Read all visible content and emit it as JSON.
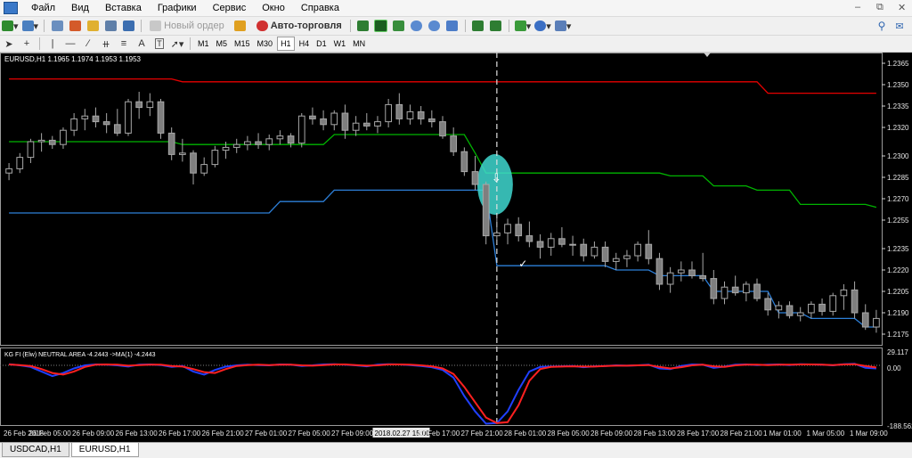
{
  "menu": [
    "Файл",
    "Вид",
    "Вставка",
    "Графики",
    "Сервис",
    "Окно",
    "Справка"
  ],
  "toolbar": {
    "new_order": "Новый ордер",
    "auto_trading": "Авто-торговля"
  },
  "timeframes": [
    "M1",
    "M5",
    "M15",
    "M30",
    "H1",
    "H4",
    "D1",
    "W1",
    "MN"
  ],
  "active_timeframe": "H1",
  "chart": {
    "header": "EURUSD,H1  1.1965 1.1974 1.1953 1.1953",
    "price_labels": [
      "1.2365",
      "1.2350",
      "1.2335",
      "1.2320",
      "1.2300",
      "1.2285",
      "1.2270",
      "1.2255",
      "1.2235",
      "1.2220",
      "1.2205",
      "1.2190",
      "1.2175"
    ],
    "time_labels": [
      "26 Feb 2018",
      "26 Feb 05:00",
      "26 Feb 09:00",
      "26 Feb 13:00",
      "26 Feb 17:00",
      "26 Feb 21:00",
      "27 Feb 01:00",
      "27 Feb 05:00",
      "27 Feb 09:00",
      "2018.02.27 15:00",
      "27 Feb 17:00",
      "27 Feb 21:00",
      "28 Feb 01:00",
      "28 Feb 05:00",
      "28 Feb 09:00",
      "28 Feb 13:00",
      "28 Feb 17:00",
      "28 Feb 21:00",
      "1 Mar 01:00",
      "1 Mar 05:00",
      "1 Mar 09:00"
    ],
    "indicator_header": "KG FI   (Elw)   NEUTRAL AREA   -4.2443  ->MA(1) -4.2443",
    "indicator_scale": [
      "29.117",
      "0.00",
      "-188.562"
    ]
  },
  "chart_data": {
    "type": "candlestick",
    "symbol": "EURUSD",
    "timeframe": "H1",
    "ylim": [
      1.217,
      1.237
    ],
    "candles_ohlc": [
      [
        1.2288,
        1.2295,
        1.2283,
        1.2291
      ],
      [
        1.2291,
        1.2302,
        1.2288,
        1.2299
      ],
      [
        1.2299,
        1.2312,
        1.2295,
        1.231
      ],
      [
        1.231,
        1.2316,
        1.2303,
        1.2311
      ],
      [
        1.2311,
        1.2314,
        1.2305,
        1.2308
      ],
      [
        1.2308,
        1.232,
        1.2305,
        1.2318
      ],
      [
        1.2318,
        1.233,
        1.2314,
        1.2326
      ],
      [
        1.2326,
        1.2333,
        1.2318,
        1.2328
      ],
      [
        1.2328,
        1.2334,
        1.232,
        1.2324
      ],
      [
        1.2324,
        1.233,
        1.2316,
        1.2322
      ],
      [
        1.2322,
        1.2333,
        1.2314,
        1.2316
      ],
      [
        1.2316,
        1.234,
        1.2314,
        1.2338
      ],
      [
        1.2338,
        1.2345,
        1.2326,
        1.2334
      ],
      [
        1.2334,
        1.2344,
        1.2328,
        1.2338
      ],
      [
        1.2338,
        1.234,
        1.2312,
        1.2316
      ],
      [
        1.2316,
        1.232,
        1.2297,
        1.2301
      ],
      [
        1.2301,
        1.2312,
        1.2296,
        1.2302
      ],
      [
        1.2302,
        1.2304,
        1.228,
        1.2288
      ],
      [
        1.2288,
        1.2299,
        1.2286,
        1.2294
      ],
      [
        1.2294,
        1.2307,
        1.2292,
        1.2304
      ],
      [
        1.2304,
        1.231,
        1.2298,
        1.2306
      ],
      [
        1.2306,
        1.2312,
        1.2302,
        1.2308
      ],
      [
        1.2308,
        1.2314,
        1.2304,
        1.231
      ],
      [
        1.231,
        1.2316,
        1.2305,
        1.2308
      ],
      [
        1.2308,
        1.2315,
        1.2304,
        1.2312
      ],
      [
        1.2312,
        1.2318,
        1.2308,
        1.2314
      ],
      [
        1.2314,
        1.2316,
        1.2306,
        1.2309
      ],
      [
        1.2309,
        1.233,
        1.2306,
        1.2328
      ],
      [
        1.2328,
        1.2334,
        1.2322,
        1.2326
      ],
      [
        1.2326,
        1.2332,
        1.2318,
        1.2322
      ],
      [
        1.2322,
        1.2332,
        1.2318,
        1.233
      ],
      [
        1.233,
        1.2336,
        1.2312,
        1.2318
      ],
      [
        1.2318,
        1.2328,
        1.2314,
        1.2323
      ],
      [
        1.2323,
        1.233,
        1.2318,
        1.2321
      ],
      [
        1.2321,
        1.2328,
        1.2316,
        1.2324
      ],
      [
        1.2324,
        1.234,
        1.232,
        1.2336
      ],
      [
        1.2336,
        1.2344,
        1.2322,
        1.2326
      ],
      [
        1.2326,
        1.2336,
        1.2322,
        1.2331
      ],
      [
        1.2331,
        1.2335,
        1.2322,
        1.2326
      ],
      [
        1.2326,
        1.2332,
        1.232,
        1.2324
      ],
      [
        1.2324,
        1.2328,
        1.2312,
        1.2314
      ],
      [
        1.2314,
        1.232,
        1.23,
        1.2303
      ],
      [
        1.2303,
        1.2306,
        1.2286,
        1.2289
      ],
      [
        1.2289,
        1.23,
        1.2276,
        1.228
      ],
      [
        1.228,
        1.2282,
        1.2238,
        1.2244
      ],
      [
        1.2244,
        1.2258,
        1.2238,
        1.2246
      ],
      [
        1.2246,
        1.2256,
        1.2238,
        1.2252
      ],
      [
        1.2252,
        1.2257,
        1.224,
        1.2244
      ],
      [
        1.2244,
        1.2254,
        1.2236,
        1.224
      ],
      [
        1.224,
        1.2245,
        1.2228,
        1.2236
      ],
      [
        1.2236,
        1.2246,
        1.223,
        1.2242
      ],
      [
        1.2242,
        1.225,
        1.2236,
        1.2238
      ],
      [
        1.2238,
        1.2244,
        1.223,
        1.2238
      ],
      [
        1.2238,
        1.2242,
        1.2226,
        1.223
      ],
      [
        1.223,
        1.224,
        1.2228,
        1.2236
      ],
      [
        1.2236,
        1.224,
        1.2222,
        1.2226
      ],
      [
        1.2226,
        1.2232,
        1.222,
        1.2228
      ],
      [
        1.2228,
        1.2234,
        1.2222,
        1.223
      ],
      [
        1.223,
        1.224,
        1.2226,
        1.2238
      ],
      [
        1.2238,
        1.2248,
        1.2224,
        1.2228
      ],
      [
        1.2228,
        1.2232,
        1.2206,
        1.221
      ],
      [
        1.221,
        1.2222,
        1.2204,
        1.2218
      ],
      [
        1.2218,
        1.2226,
        1.2212,
        1.222
      ],
      [
        1.222,
        1.2226,
        1.2214,
        1.2216
      ],
      [
        1.2216,
        1.2232,
        1.2212,
        1.2214
      ],
      [
        1.2214,
        1.222,
        1.2196,
        1.22
      ],
      [
        1.22,
        1.2212,
        1.2196,
        1.2208
      ],
      [
        1.2208,
        1.2216,
        1.2202,
        1.2204
      ],
      [
        1.2204,
        1.2212,
        1.2198,
        1.221
      ],
      [
        1.221,
        1.2214,
        1.2198,
        1.22
      ],
      [
        1.22,
        1.2204,
        1.2188,
        1.2192
      ],
      [
        1.2192,
        1.2198,
        1.2186,
        1.2195
      ],
      [
        1.2195,
        1.2198,
        1.2186,
        1.2188
      ],
      [
        1.2188,
        1.2194,
        1.2184,
        1.219
      ],
      [
        1.219,
        1.2198,
        1.2186,
        1.2196
      ],
      [
        1.2196,
        1.22,
        1.2188,
        1.2191
      ],
      [
        1.2191,
        1.2204,
        1.2188,
        1.2202
      ],
      [
        1.2202,
        1.221,
        1.2192,
        1.2206
      ],
      [
        1.2206,
        1.2212,
        1.2186,
        1.219
      ],
      [
        1.219,
        1.2196,
        1.2178,
        1.218
      ],
      [
        1.218,
        1.2192,
        1.2176,
        1.2186
      ]
    ],
    "series": [
      {
        "name": "",
        "color": "#e60000",
        "values": [
          1.2354,
          1.2354,
          1.2354,
          1.2354,
          1.2354,
          1.2354,
          1.2354,
          1.2354,
          1.2354,
          1.2354,
          1.2354,
          1.2354,
          1.2354,
          1.2354,
          1.2354,
          1.2354,
          1.2352,
          1.2352,
          1.2352,
          1.2352,
          1.2352,
          1.2352,
          1.2352,
          1.2352,
          1.2352,
          1.2352,
          1.2352,
          1.2352,
          1.2352,
          1.2352,
          1.2352,
          1.2352,
          1.2352,
          1.2352,
          1.2352,
          1.2352,
          1.2352,
          1.2352,
          1.2352,
          1.2352,
          1.2352,
          1.2352,
          1.2352,
          1.2352,
          1.2352,
          1.2352,
          1.2352,
          1.2352,
          1.2352,
          1.2352,
          1.2352,
          1.2352,
          1.2352,
          1.2352,
          1.2352,
          1.2352,
          1.2352,
          1.2352,
          1.2352,
          1.2352,
          1.2352,
          1.2352,
          1.2352,
          1.2352,
          1.2352,
          1.2352,
          1.2352,
          1.2352,
          1.2352,
          1.2352,
          1.2344,
          1.2344,
          1.2344,
          1.2344,
          1.2344,
          1.2344,
          1.2344,
          1.2344,
          1.2344,
          1.2344,
          1.2344
        ]
      },
      {
        "name": "",
        "color": "#00b400",
        "values": [
          1.231,
          1.231,
          1.231,
          1.231,
          1.231,
          1.231,
          1.231,
          1.231,
          1.231,
          1.231,
          1.231,
          1.231,
          1.231,
          1.231,
          1.231,
          1.231,
          1.2308,
          1.2308,
          1.2308,
          1.2308,
          1.2308,
          1.2308,
          1.2308,
          1.2308,
          1.2308,
          1.2308,
          1.2308,
          1.2308,
          1.2308,
          1.2308,
          1.2315,
          1.2315,
          1.2315,
          1.2315,
          1.2315,
          1.2315,
          1.2315,
          1.2315,
          1.2315,
          1.2315,
          1.2315,
          1.2315,
          1.2315,
          1.2302,
          1.2288,
          1.2288,
          1.2288,
          1.2288,
          1.2288,
          1.2288,
          1.2288,
          1.2288,
          1.2288,
          1.2288,
          1.2288,
          1.2288,
          1.2288,
          1.2288,
          1.2288,
          1.2288,
          1.2288,
          1.2286,
          1.2286,
          1.2286,
          1.2286,
          1.2279,
          1.2279,
          1.2279,
          1.2279,
          1.2276,
          1.2276,
          1.2276,
          1.2276,
          1.2266,
          1.2266,
          1.2266,
          1.2266,
          1.2266,
          1.2266,
          1.2266,
          1.2264
        ]
      },
      {
        "name": "",
        "color": "#2d7fd8",
        "values": [
          1.226,
          1.226,
          1.226,
          1.226,
          1.226,
          1.226,
          1.226,
          1.226,
          1.226,
          1.226,
          1.226,
          1.226,
          1.226,
          1.226,
          1.226,
          1.226,
          1.226,
          1.226,
          1.226,
          1.226,
          1.226,
          1.226,
          1.226,
          1.226,
          1.226,
          1.2268,
          1.2268,
          1.2268,
          1.2268,
          1.2268,
          1.2276,
          1.2276,
          1.2276,
          1.2276,
          1.2276,
          1.2276,
          1.2276,
          1.2276,
          1.2276,
          1.2276,
          1.2276,
          1.2276,
          1.2276,
          1.2276,
          1.2276,
          1.2223,
          1.2223,
          1.2223,
          1.2223,
          1.2223,
          1.2223,
          1.2223,
          1.2223,
          1.2223,
          1.2223,
          1.2223,
          1.222,
          1.222,
          1.222,
          1.222,
          1.2216,
          1.2216,
          1.2216,
          1.2216,
          1.2216,
          1.2205,
          1.2205,
          1.2205,
          1.2205,
          1.2205,
          1.2205,
          1.219,
          1.219,
          1.219,
          1.2186,
          1.2186,
          1.2186,
          1.2186,
          1.2186,
          1.218,
          1.218
        ]
      }
    ],
    "signal_index": 45,
    "vline_index": 45,
    "indicator": {
      "ylim": [
        -188.562,
        29.117
      ],
      "blue": [
        4,
        0,
        -5,
        -20,
        -35,
        -25,
        -10,
        0,
        3,
        2,
        0,
        -4,
        2,
        3,
        1,
        -5,
        -2,
        -20,
        -30,
        -15,
        -4,
        0,
        2,
        1,
        0,
        3,
        2,
        -2,
        0,
        3,
        4,
        2,
        0,
        -3,
        2,
        4,
        3,
        1,
        -2,
        -6,
        -15,
        -40,
        -100,
        -150,
        -190,
        -188,
        -150,
        -80,
        -20,
        -5,
        -4,
        -3,
        -2,
        -6,
        -3,
        -2,
        0,
        -1,
        0,
        2,
        -10,
        -12,
        -2,
        3,
        2,
        -8,
        -4,
        2,
        3,
        1,
        2,
        3,
        1,
        4,
        3,
        2,
        0,
        4,
        5,
        -8,
        -10
      ],
      "red": [
        3,
        1,
        -2,
        -12,
        -25,
        -30,
        -20,
        -5,
        2,
        3,
        2,
        -1,
        1,
        2,
        2,
        -2,
        -4,
        -12,
        -22,
        -25,
        -12,
        -2,
        1,
        2,
        1,
        2,
        2,
        0,
        -1,
        1,
        3,
        3,
        1,
        -1,
        0,
        3,
        3,
        2,
        0,
        -3,
        -10,
        -28,
        -70,
        -120,
        -170,
        -188,
        -185,
        -130,
        -50,
        -12,
        -5,
        -4,
        -3,
        -4,
        -4,
        -2,
        -1,
        -1,
        0,
        1,
        -5,
        -10,
        -6,
        0,
        2,
        -3,
        -5,
        0,
        2,
        2,
        1,
        2,
        2,
        3,
        3,
        2,
        1,
        3,
        4,
        -2,
        -7
      ]
    }
  }
}
